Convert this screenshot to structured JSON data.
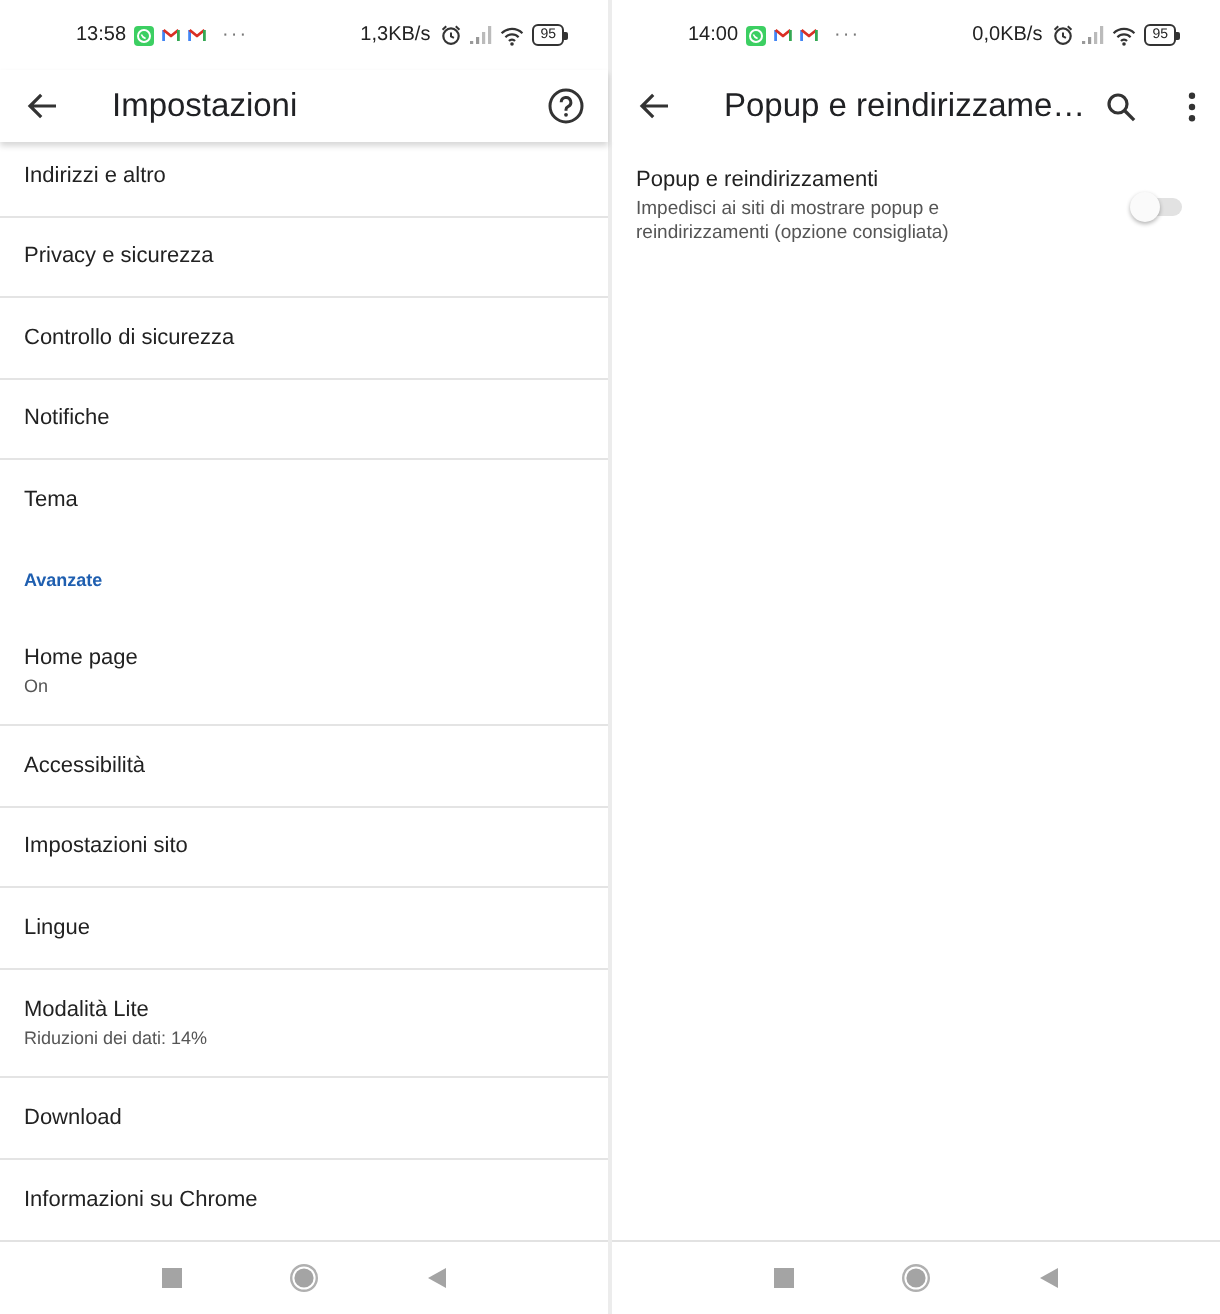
{
  "screens": [
    {
      "kind": "settings",
      "status_bar": {
        "time": "13:58",
        "overflow": "···",
        "speed": "1,3KB/s",
        "battery": "95"
      },
      "app_bar": {
        "title": "Impostazioni",
        "shadow": true
      },
      "items": [
        {
          "kind": "item",
          "title": "Indirizzi e altro"
        },
        {
          "kind": "item",
          "title": "Privacy e sicurezza"
        },
        {
          "kind": "item",
          "title": "Controllo di sicurezza"
        },
        {
          "kind": "item",
          "title": "Notifiche"
        },
        {
          "kind": "item",
          "title": "Tema"
        },
        {
          "kind": "header",
          "title": "Avanzate"
        },
        {
          "kind": "item",
          "title": "Home page",
          "summary": "On"
        },
        {
          "kind": "item",
          "title": "Accessibilità"
        },
        {
          "kind": "item",
          "title": "Impostazioni sito"
        },
        {
          "kind": "item",
          "title": "Lingue"
        },
        {
          "kind": "item",
          "title": "Modalità Lite",
          "summary": "Riduzioni dei dati: 14%"
        },
        {
          "kind": "item",
          "title": "Download"
        },
        {
          "kind": "item",
          "title": "Informazioni su Chrome"
        }
      ]
    },
    {
      "kind": "site_setting",
      "status_bar": {
        "time": "14:00",
        "overflow": "···",
        "speed": "0,0KB/s",
        "battery": "95"
      },
      "app_bar": {
        "title": "Popup e reindirizzame…",
        "shadow": false
      },
      "items": [
        {
          "kind": "toggle",
          "title": "Popup e reindirizzamenti",
          "summary": "Impedisci ai siti di mostrare popup e reindirizzamenti (opzione consigliata)",
          "on": false
        }
      ]
    }
  ]
}
